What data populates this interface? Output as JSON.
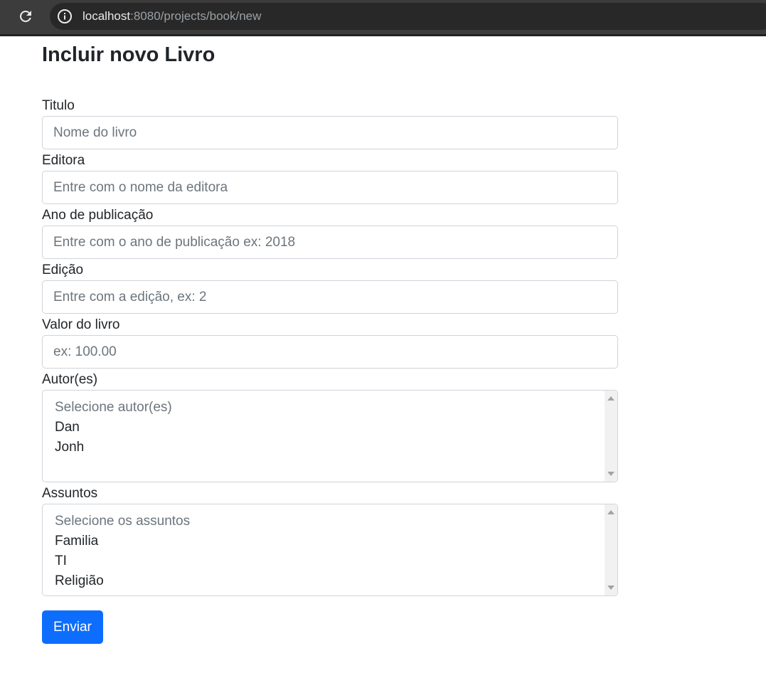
{
  "browser": {
    "url_host": "localhost",
    "url_rest": ":8080/projects/book/new"
  },
  "page": {
    "title": "Incluir novo Livro"
  },
  "form": {
    "titulo": {
      "label": "Titulo",
      "placeholder": "Nome do livro"
    },
    "editora": {
      "label": "Editora",
      "placeholder": "Entre com o nome da editora"
    },
    "ano": {
      "label": "Ano de publicação",
      "placeholder": "Entre com o ano de publicação ex: 2018"
    },
    "edicao": {
      "label": "Edição",
      "placeholder": "Entre com a edição, ex: 2"
    },
    "valor": {
      "label": "Valor do livro",
      "placeholder": "ex: 100.00"
    },
    "autores": {
      "label": "Autor(es)",
      "options": [
        "Selecione autor(es)",
        "Dan",
        "Jonh"
      ]
    },
    "assuntos": {
      "label": "Assuntos",
      "options": [
        "Selecione os assuntos",
        "Familia",
        "TI",
        "Religião"
      ]
    },
    "submit_label": "Enviar"
  },
  "colors": {
    "primary": "#0d6efd",
    "placeholder": "#6c757d",
    "border": "#ced4da"
  }
}
